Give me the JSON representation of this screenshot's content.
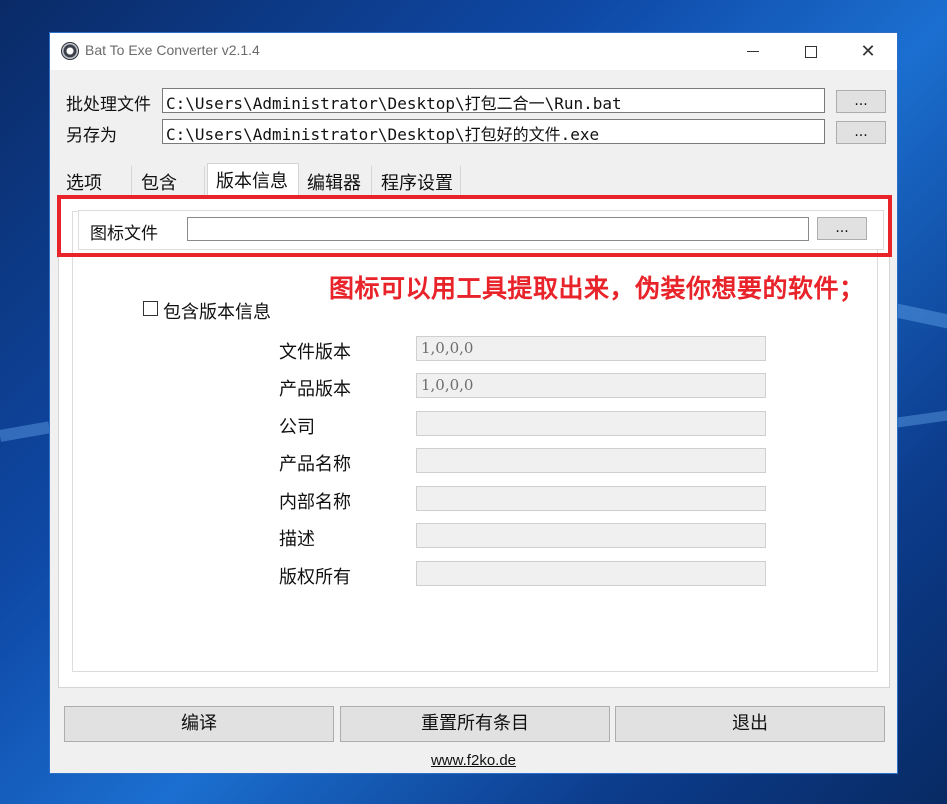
{
  "window": {
    "title": "Bat To Exe Converter v2.1.4"
  },
  "files": {
    "batch_label": "批处理文件",
    "batch_value": "C:\\Users\\Administrator\\Desktop\\打包二合一\\Run.bat",
    "save_label": "另存为",
    "save_value": "C:\\Users\\Administrator\\Desktop\\打包好的文件.exe",
    "browse_label": "..."
  },
  "tabs": [
    "选项",
    "包含",
    "版本信息",
    "编辑器",
    "程序设置"
  ],
  "active_tab": "版本信息",
  "icon_file": {
    "label": "图标文件",
    "value": "",
    "browse_label": "..."
  },
  "annotation": "图标可以用工具提取出来，伪装你想要的软件；",
  "version_info": {
    "include_label": "包含版本信息",
    "include_checked": false,
    "fields": [
      {
        "label": "文件版本",
        "value": "1,0,0,0"
      },
      {
        "label": "产品版本",
        "value": "1,0,0,0"
      },
      {
        "label": "公司",
        "value": ""
      },
      {
        "label": "产品名称",
        "value": ""
      },
      {
        "label": "内部名称",
        "value": ""
      },
      {
        "label": "描述",
        "value": ""
      },
      {
        "label": "版权所有",
        "value": ""
      }
    ]
  },
  "footer": {
    "compile": "编译",
    "reset": "重置所有条目",
    "exit": "退出",
    "link": "www.f2ko.de"
  },
  "colors": {
    "annotation": "#e8232a",
    "window_border": "#2b6fc9"
  }
}
